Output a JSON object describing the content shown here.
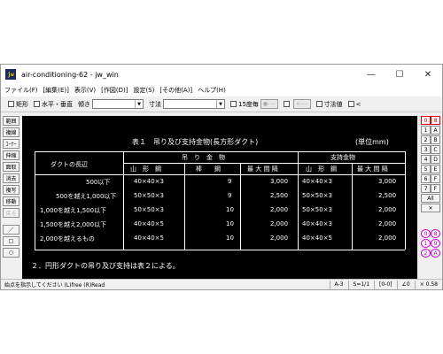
{
  "window": {
    "title": "air-conditioning-62 - jw_win",
    "app_icon": "jw",
    "minimize": "—",
    "maximize": "☐",
    "close": "✕"
  },
  "menubar": [
    "ファイル(F)",
    "[編集(E)]",
    "表示(V)",
    "[作図(D)]",
    "設定(S)",
    "[その他(A)]",
    "ヘルプ(H)"
  ],
  "toolbar": {
    "rect": "矩形",
    "hv": "水平・垂直",
    "tilt": "傾き",
    "dim": "寸法",
    "deg15": "15度毎",
    "btn1": "●----",
    "btn2": "<----",
    "dim_val": "寸法値",
    "lt": "<"
  },
  "left_panel": [
    "範囲",
    "複線",
    "ｺｰﾅｰ",
    "伸縮",
    "面取",
    "消去",
    "複写",
    "移動",
    "戻る"
  ],
  "right_panel": {
    "rows": [
      [
        "0",
        "8"
      ],
      [
        "1",
        "A"
      ],
      [
        "2",
        "B"
      ],
      [
        "3",
        "C"
      ],
      [
        "4",
        "D"
      ],
      [
        "5",
        "E"
      ],
      [
        "6",
        "F"
      ],
      [
        "7",
        "F"
      ]
    ],
    "all": "All",
    "x": "✕",
    "circ_rows": [
      [
        "0",
        "8"
      ],
      [
        "1",
        "9"
      ],
      [
        "2",
        "A"
      ]
    ]
  },
  "drawing": {
    "title": "表１　吊り及び支持金物(長方形ダクト)",
    "unit": "(単位mm)",
    "hdr_duct": "ダクトの長辺",
    "hdr_hang": "吊　り　金　物",
    "hdr_support": "支持金物",
    "sub_angle": "山　形　鋼",
    "sub_rod": "棒　　鋼",
    "sub_interval": "最 大 間 隔",
    "sub_angle2": "山　形　鋼",
    "sub_interval2": "最 大 間 隔",
    "rows": [
      {
        "len": "500以下",
        "angle": "40×40×3",
        "rod": "9",
        "int": "3,000",
        "s_angle": "40×40×3",
        "s_int": "3,000"
      },
      {
        "len": "500を越え1,000以下",
        "angle": "50×50×3",
        "rod": "9",
        "int": "2,500",
        "s_angle": "50×50×3",
        "s_int": "2,500"
      },
      {
        "len": "1,000を越え1,500以下",
        "angle": "50×50×3",
        "rod": "10",
        "int": "2,000",
        "s_angle": "50×50×3",
        "s_int": "2,000"
      },
      {
        "len": "1,500を越え2,000以下",
        "angle": "40×40×5",
        "rod": "10",
        "int": "2,000",
        "s_angle": "40×40×3",
        "s_int": "2,000"
      },
      {
        "len": "2,000を越えるもの",
        "angle": "40×40×5",
        "rod": "10",
        "int": "2,000",
        "s_angle": "40×40×5",
        "s_int": "2,000"
      }
    ],
    "note": "２．円形ダクトの吊り及び支持は表２による。"
  },
  "status": {
    "message": "始点を指示してください (L)free (R)Read",
    "paper": "A-3",
    "scale": "S=1/1",
    "layer": "[0-0]",
    "angle": "∠0",
    "zoom": "× 0.58"
  }
}
